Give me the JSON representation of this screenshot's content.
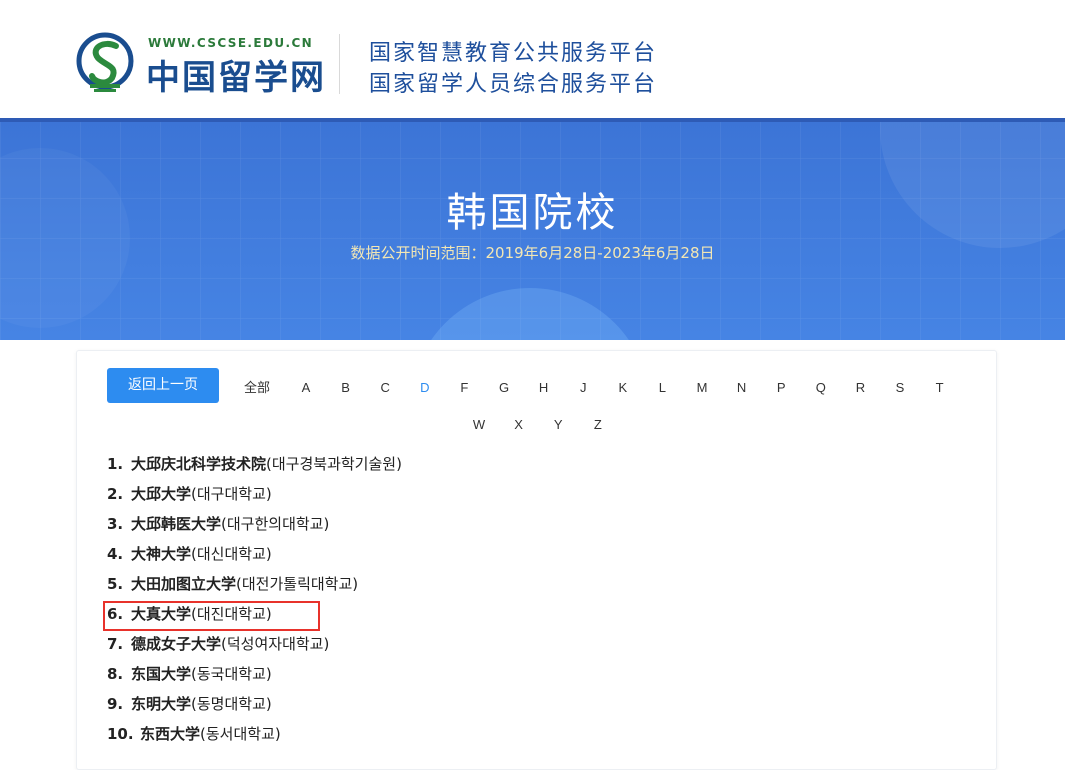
{
  "header": {
    "logo_url": "WWW.CSCSE.EDU.CN",
    "logo_name": "中国留学网",
    "platform_line1": "国家智慧教育公共服务平台",
    "platform_line2": "国家留学人员综合服务平台"
  },
  "banner": {
    "title": "韩国院校",
    "subtitle": "数据公开时间范围：2019年6月28日-2023年6月28日"
  },
  "nav": {
    "back_label": "返回上一页",
    "all_label": "全部",
    "active_letter": "D",
    "letters_row1": [
      "A",
      "B",
      "C",
      "D",
      "F",
      "G",
      "H",
      "J",
      "K",
      "L",
      "M",
      "N",
      "P",
      "Q",
      "R",
      "S",
      "T"
    ],
    "letters_row2": [
      "W",
      "X",
      "Y",
      "Z"
    ]
  },
  "universities": [
    {
      "num": "1.",
      "name": "大邱庆北科学技术院",
      "korean": "(대구경북과학기술원)"
    },
    {
      "num": "2.",
      "name": "大邱大学",
      "korean": "(대구대학교)"
    },
    {
      "num": "3.",
      "name": "大邱韩医大学",
      "korean": "(대구한의대학교)"
    },
    {
      "num": "4.",
      "name": "大神大学",
      "korean": "(대신대학교)"
    },
    {
      "num": "5.",
      "name": "大田加图立大学",
      "korean": "(대전가톨릭대학교)"
    },
    {
      "num": "6.",
      "name": "大真大学",
      "korean": "(대진대학교)"
    },
    {
      "num": "7.",
      "name": "德成女子大学",
      "korean": "(덕성여자대학교)"
    },
    {
      "num": "8.",
      "name": "东国大学",
      "korean": "(동국대학교)"
    },
    {
      "num": "9.",
      "name": "东明大学",
      "korean": "(동명대학교)"
    },
    {
      "num": "10.",
      "name": "东西大学",
      "korean": "(동서대학교)"
    }
  ],
  "colors": {
    "accent": "#2d8cf0",
    "banner": "#3f7adb",
    "highlight": "#e8322b"
  }
}
